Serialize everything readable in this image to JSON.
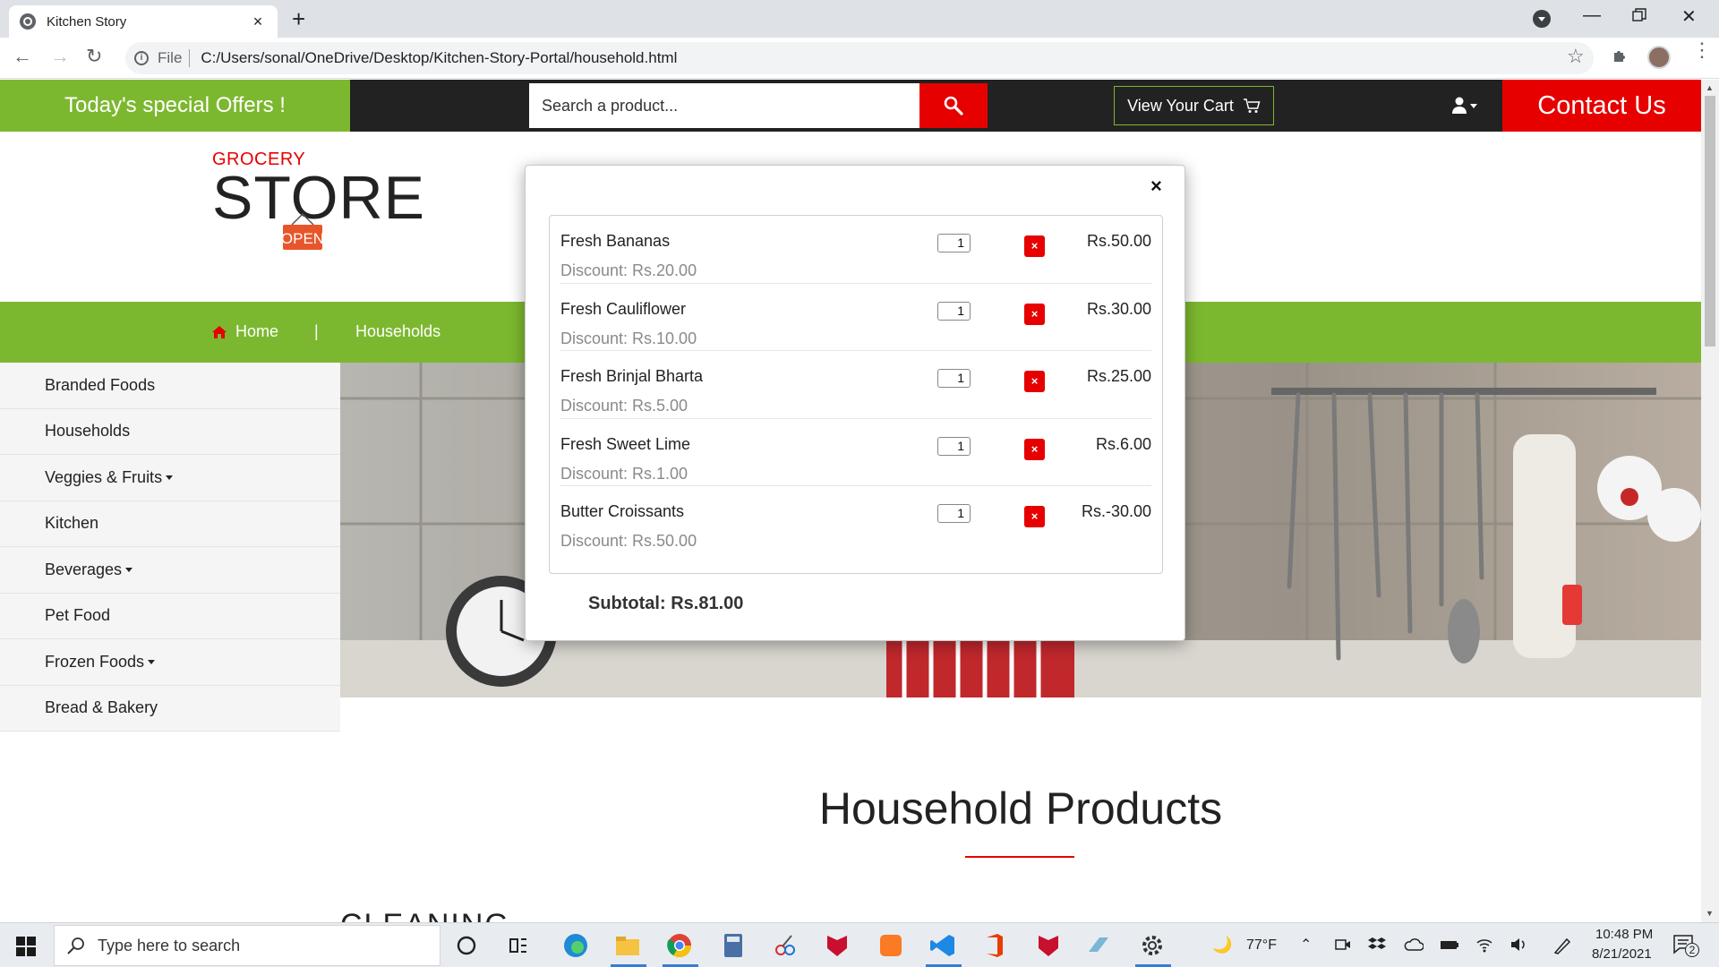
{
  "browser": {
    "tab_title": "Kitchen Story",
    "tab_close": "×",
    "new_tab": "+",
    "file_label": "File",
    "url": "C:/Users/sonal/OneDrive/Desktop/Kitchen-Story-Portal/household.html"
  },
  "header": {
    "offers": "Today's special Offers !",
    "search_placeholder": "Search a product...",
    "cart_label": "View Your Cart",
    "contact_label": "Contact Us"
  },
  "logo": {
    "grocery": "GROCERY",
    "store": "STORE",
    "open_sign": "OPEN"
  },
  "nav": {
    "home": "Home",
    "separator": "|",
    "households": "Households"
  },
  "sidebar": {
    "items": [
      {
        "label": "Branded Foods",
        "has_caret": false
      },
      {
        "label": "Households",
        "has_caret": false
      },
      {
        "label": "Veggies & Fruits",
        "has_caret": true
      },
      {
        "label": "Kitchen",
        "has_caret": false
      },
      {
        "label": "Beverages",
        "has_caret": true
      },
      {
        "label": "Pet Food",
        "has_caret": false
      },
      {
        "label": "Frozen Foods",
        "has_caret": true
      },
      {
        "label": "Bread & Bakery",
        "has_caret": false
      }
    ]
  },
  "main": {
    "section_title": "Household Products",
    "category_heading": "CLEANING"
  },
  "cart_modal": {
    "close": "×",
    "items": [
      {
        "name": "Fresh Bananas",
        "discount": "Discount: Rs.20.00",
        "qty": "1",
        "remove": "×",
        "price": "Rs.50.00"
      },
      {
        "name": "Fresh Cauliflower",
        "discount": "Discount: Rs.10.00",
        "qty": "1",
        "remove": "×",
        "price": "Rs.30.00"
      },
      {
        "name": "Fresh Brinjal Bharta",
        "discount": "Discount: Rs.5.00",
        "qty": "1",
        "remove": "×",
        "price": "Rs.25.00"
      },
      {
        "name": "Fresh Sweet Lime",
        "discount": "Discount: Rs.1.00",
        "qty": "1",
        "remove": "×",
        "price": "Rs.6.00"
      },
      {
        "name": "Butter Croissants",
        "discount": "Discount: Rs.50.00",
        "qty": "1",
        "remove": "×",
        "price": "Rs.-30.00"
      }
    ],
    "subtotal": "Subtotal: Rs.81.00"
  },
  "taskbar": {
    "search_placeholder": "Type here to search",
    "weather": "77°F",
    "time": "10:48 PM",
    "date": "8/21/2021",
    "notifications": "2"
  },
  "colors": {
    "green": "#7cb82f",
    "red": "#e60000",
    "dark": "#222222"
  }
}
